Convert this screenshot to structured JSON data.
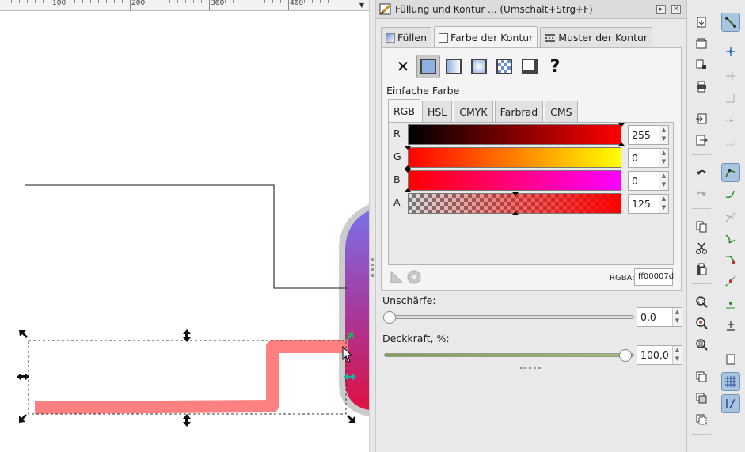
{
  "ruler": {
    "labels": [
      "100",
      "200",
      "300",
      "400"
    ]
  },
  "dialog": {
    "title": "Füllung und Kontur ... (Umschalt+Strg+F)"
  },
  "tabs": [
    {
      "label": "Füllen"
    },
    {
      "label": "Farbe der Kontur"
    },
    {
      "label": "Muster der Kontur"
    }
  ],
  "paint_types": [
    "none-icon",
    "flat-color-icon",
    "linear-gradient-icon",
    "radial-gradient-icon",
    "pattern-icon",
    "swatch-icon",
    "unset-icon"
  ],
  "paint_mode_label": "Einfache Farbe",
  "color_tabs": [
    "RGB",
    "HSL",
    "CMYK",
    "Farbrad",
    "CMS"
  ],
  "channels": [
    {
      "label": "R",
      "value": "255"
    },
    {
      "label": "G",
      "value": "0"
    },
    {
      "label": "B",
      "value": "0"
    },
    {
      "label": "A",
      "value": "125"
    }
  ],
  "rgba": {
    "label": "RGBA:",
    "value": "ff00007d"
  },
  "blur": {
    "label": "Unschärfe:",
    "value": "0,0",
    "fraction": 0.0
  },
  "opacity": {
    "label": "Deckkraft, %:",
    "value": "100,0",
    "fraction": 1.0
  },
  "colors": {
    "accent": "#ff0000",
    "stroke_preview": "#ff8080"
  }
}
